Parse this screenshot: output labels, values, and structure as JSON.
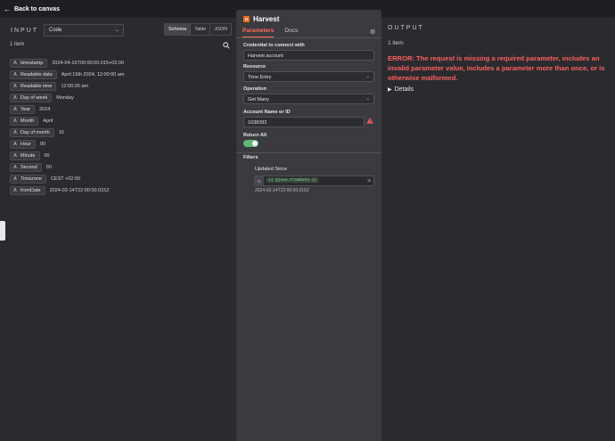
{
  "topbar": {
    "back_label": "Back to canvas"
  },
  "input_panel": {
    "title": "INPUT",
    "source_select": "Code",
    "views": [
      "Schema",
      "Table",
      "JSON"
    ],
    "active_view": "Schema",
    "item_count": "1 item",
    "fields": [
      {
        "name": "timestamp",
        "value": "2024-04-15T00:00:00.015+02:00"
      },
      {
        "name": "Readable date",
        "value": "April 15th 2024, 12:00:00 am"
      },
      {
        "name": "Readable time",
        "value": "12:00:00 am"
      },
      {
        "name": "Day of week",
        "value": "Monday"
      },
      {
        "name": "Year",
        "value": "2024"
      },
      {
        "name": "Month",
        "value": "April"
      },
      {
        "name": "Day of month",
        "value": "15"
      },
      {
        "name": "Hour",
        "value": "00"
      },
      {
        "name": "Minute",
        "value": "00"
      },
      {
        "name": "Second",
        "value": "00"
      },
      {
        "name": "Timezone",
        "value": "CEST +02:00"
      },
      {
        "name": "fromDate",
        "value": "2024-02-14T22:00:00.015Z"
      }
    ],
    "type_glyph": "A"
  },
  "node": {
    "logo_letter": "H",
    "title": "Harvest",
    "tabs": [
      "Parameters",
      "Docs"
    ],
    "active_tab": "Parameters",
    "credential_label": "Credential to connect with",
    "credential_value": "Harvest account",
    "resource_label": "Resource",
    "resource_value": "Time Entry",
    "operation_label": "Operation",
    "operation_value": "Get Many",
    "account_label": "Account Name or ID",
    "account_value": "1038392",
    "return_all_label": "Return All",
    "filters_label": "Filters",
    "updated_since_label": "Updated Since",
    "expr_prefix": "fx",
    "updated_since_expr": "{{ $json.fromDate }}",
    "updated_since_result": "2024-02-14T22:00:00.015Z"
  },
  "output_panel": {
    "title": "OUTPUT",
    "item_count": "1 item",
    "error": "ERROR: The request is missing a required parameter, includes an invalid parameter value, includes a parameter more than once, or is otherwise malformed.",
    "details_label": "Details"
  },
  "colors": {
    "accent": "#ff6d5a",
    "error": "#ff5e5e",
    "toggle_on": "#5fb877",
    "harvest_brand": "#f36c21"
  }
}
